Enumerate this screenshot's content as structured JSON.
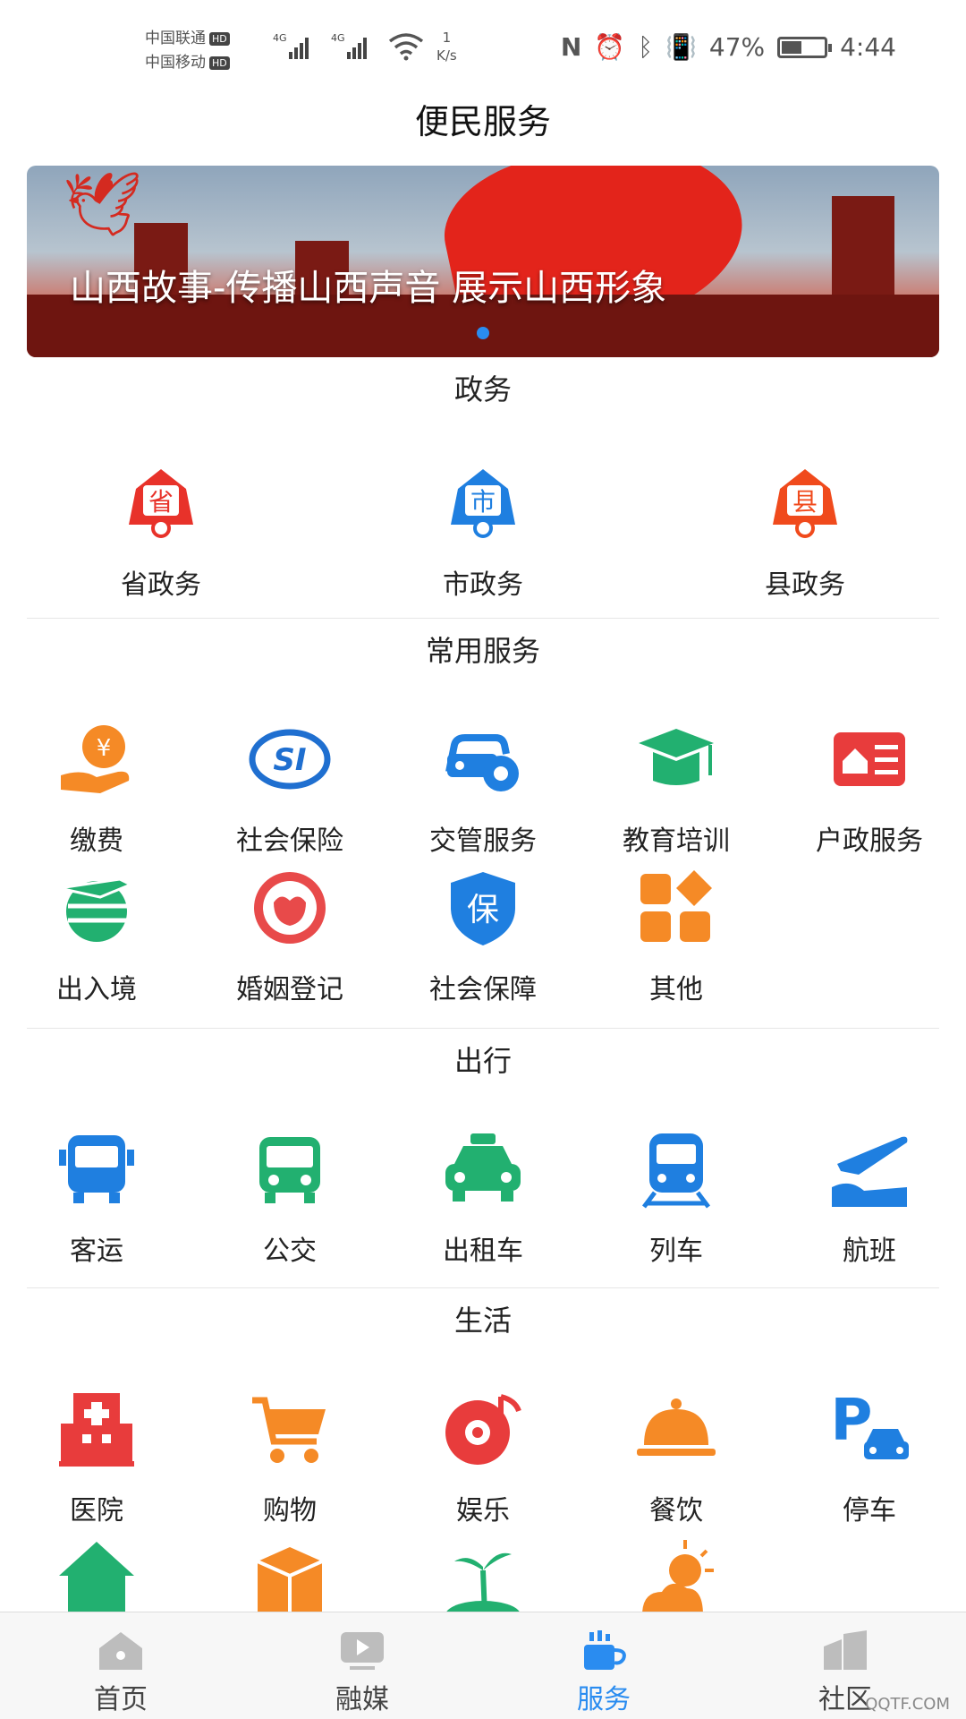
{
  "status_bar": {
    "carrier1": "中国联通",
    "carrier2": "中国移动",
    "hd": "HD",
    "net1": "4G",
    "net2": "4G",
    "speed_value": "1",
    "speed_unit": "K/s",
    "battery_percent": "47%",
    "time": "4:44"
  },
  "header": {
    "title": "便民服务"
  },
  "banner": {
    "caption": "山西故事-传播山西声音 展示山西形象"
  },
  "sections": {
    "gov": {
      "title": "政务",
      "items": [
        {
          "label": "省政务",
          "icon": "province-gov-icon",
          "glyph": "省",
          "color": "#e8322a"
        },
        {
          "label": "市政务",
          "icon": "city-gov-icon",
          "glyph": "市",
          "color": "#1f7fe0"
        },
        {
          "label": "县政务",
          "icon": "county-gov-icon",
          "glyph": "县",
          "color": "#f04a1c"
        }
      ]
    },
    "common": {
      "title": "常用服务",
      "items": [
        {
          "label": "缴费",
          "icon": "payment-icon",
          "color": "#f58a26"
        },
        {
          "label": "社会保险",
          "icon": "social-insurance-icon",
          "color": "#1f6fd0"
        },
        {
          "label": "交管服务",
          "icon": "traffic-service-icon",
          "color": "#1f7fe0"
        },
        {
          "label": "教育培训",
          "icon": "education-icon",
          "color": "#22b070"
        },
        {
          "label": "户政服务",
          "icon": "household-icon",
          "color": "#e83c3c"
        },
        {
          "label": "出入境",
          "icon": "exit-entry-icon",
          "color": "#22b070"
        },
        {
          "label": "婚姻登记",
          "icon": "marriage-icon",
          "color": "#e84a4a"
        },
        {
          "label": "社会保障",
          "icon": "social-security-icon",
          "color": "#1f7fe0",
          "glyph": "保"
        },
        {
          "label": "其他",
          "icon": "other-icon",
          "color": "#f58a26"
        }
      ]
    },
    "travel": {
      "title": "出行",
      "items": [
        {
          "label": "客运",
          "icon": "coach-icon",
          "color": "#1f7fe0"
        },
        {
          "label": "公交",
          "icon": "bus-icon",
          "color": "#22b070"
        },
        {
          "label": "出租车",
          "icon": "taxi-icon",
          "color": "#22b070"
        },
        {
          "label": "列车",
          "icon": "train-icon",
          "color": "#1f7fe0"
        },
        {
          "label": "航班",
          "icon": "flight-icon",
          "color": "#1f7fe0"
        }
      ]
    },
    "life": {
      "title": "生活",
      "items": [
        {
          "label": "医院",
          "icon": "hospital-icon",
          "color": "#e83c3c"
        },
        {
          "label": "购物",
          "icon": "shopping-cart-icon",
          "color": "#f58a26"
        },
        {
          "label": "娱乐",
          "icon": "entertainment-icon",
          "color": "#e83c3c"
        },
        {
          "label": "餐饮",
          "icon": "dining-icon",
          "color": "#f58a26"
        },
        {
          "label": "停车",
          "icon": "parking-icon",
          "color": "#1f7fe0",
          "glyph": "P"
        }
      ],
      "partial_icons": [
        {
          "icon": "housekeeping-icon",
          "color": "#22b070"
        },
        {
          "icon": "package-icon",
          "color": "#f58a26"
        },
        {
          "icon": "tourism-icon",
          "color": "#22b070"
        },
        {
          "icon": "weather-icon",
          "color": "#f58a26"
        }
      ]
    }
  },
  "tabbar": {
    "tabs": [
      {
        "label": "首页",
        "icon": "home-icon"
      },
      {
        "label": "融媒",
        "icon": "media-icon"
      },
      {
        "label": "服务",
        "icon": "service-icon",
        "active": true
      },
      {
        "label": "社区",
        "icon": "community-icon"
      }
    ],
    "active_color": "#2a8cf0",
    "inactive_color": "#bdbdbd"
  },
  "watermark": "QQTF.COM"
}
